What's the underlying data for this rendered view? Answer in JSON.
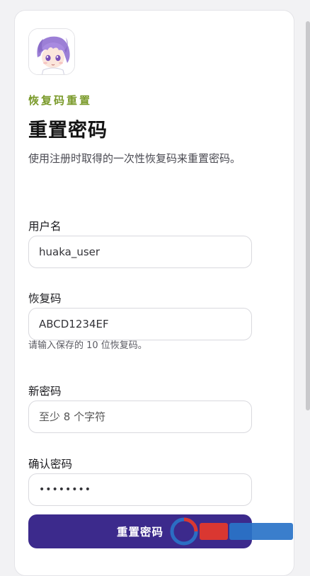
{
  "header": {
    "eyebrow": "恢复码重置",
    "title": "重置密码",
    "subtitle": "使用注册时取得的一次性恢复码来重置密码。"
  },
  "form": {
    "username": {
      "label": "用户名",
      "value": "huaka_user"
    },
    "recovery_code": {
      "label": "恢复码",
      "value": "ABCD1234EF",
      "hint": "请输入保存的 10 位恢复码。"
    },
    "new_password": {
      "label": "新密码",
      "placeholder": "至少 8 个字符"
    },
    "confirm_password": {
      "label": "确认密码",
      "value": "••••••••"
    },
    "submit_label": "重置密码"
  },
  "colors": {
    "accent": "#3c2a8c",
    "eyebrow": "#7a9a2a"
  }
}
